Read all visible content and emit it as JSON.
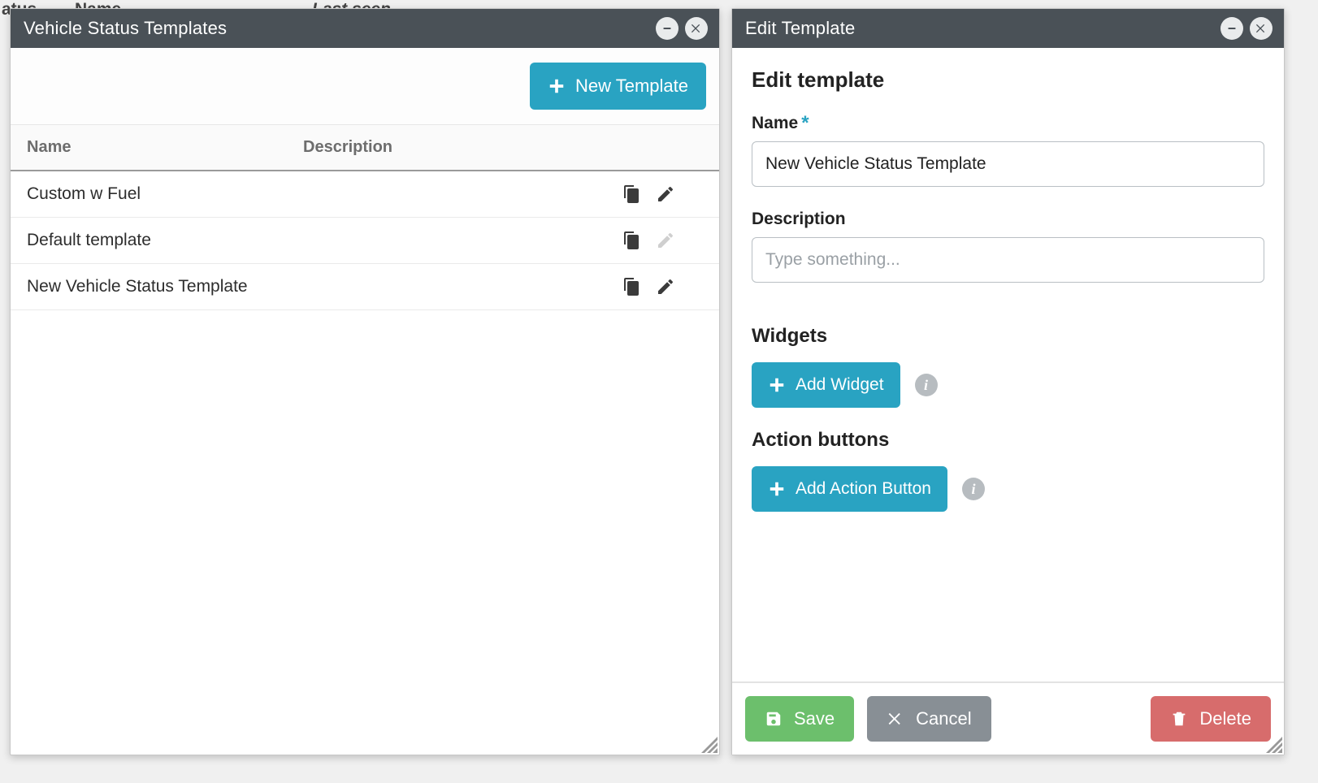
{
  "background": {
    "col_status": "atus",
    "col_name": "Name",
    "col_last_seen": "Last seen"
  },
  "templates_panel": {
    "title": "Vehicle Status Templates",
    "new_template_label": "New Template",
    "columns": {
      "name": "Name",
      "description": "Description"
    },
    "rows": [
      {
        "name": "Custom w Fuel",
        "description": "",
        "edit_disabled": false
      },
      {
        "name": "Default template",
        "description": "",
        "edit_disabled": true
      },
      {
        "name": "New Vehicle Status Template",
        "description": "",
        "edit_disabled": false
      }
    ]
  },
  "edit_panel": {
    "title": "Edit Template",
    "heading": "Edit template",
    "name_label": "Name",
    "name_value": "New Vehicle Status Template",
    "description_label": "Description",
    "description_placeholder": "Type something...",
    "description_value": "",
    "widgets_heading": "Widgets",
    "add_widget_label": "Add Widget",
    "action_buttons_heading": "Action buttons",
    "add_action_button_label": "Add Action Button",
    "footer": {
      "save": "Save",
      "cancel": "Cancel",
      "delete": "Delete"
    }
  }
}
